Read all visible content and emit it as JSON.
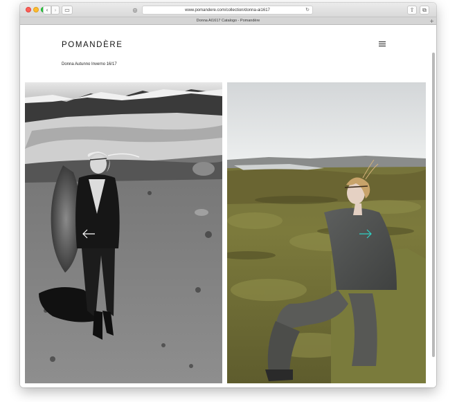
{
  "browser": {
    "url": "www.pomandere.com/collection/donna-ai1617",
    "tab_title": "Donna AI1617 Catalogo - Pomandère",
    "back_glyph": "‹",
    "forward_glyph": "›",
    "reload_glyph": "↻",
    "reader_glyph": "◎",
    "sidebar_glyph": "▭",
    "share_glyph": "⇧",
    "tabs_glyph": "⧉",
    "new_tab_glyph": "+"
  },
  "site": {
    "logo": "POMANDÈRE",
    "subtitle": "Donna Autunno Inverno 16/17"
  },
  "gallery": {
    "photos": [
      {
        "style": "black-and-white",
        "subject": "model in dark suit with fur coat on rocky volcanic landscape"
      },
      {
        "style": "color",
        "subject": "model in grey wool coat seated on mossy hillside"
      }
    ]
  },
  "colors": {
    "accent_arrow": "#2fd3c6",
    "text": "#111111",
    "close": "#fc5f57",
    "minimize": "#fdbc2e",
    "maximize": "#28c840"
  },
  "icons": [
    "menu-icon",
    "arrow-left-icon",
    "arrow-right-icon",
    "reload-icon",
    "share-icon",
    "tabs-icon",
    "sidebar-icon",
    "reader-icon"
  ]
}
